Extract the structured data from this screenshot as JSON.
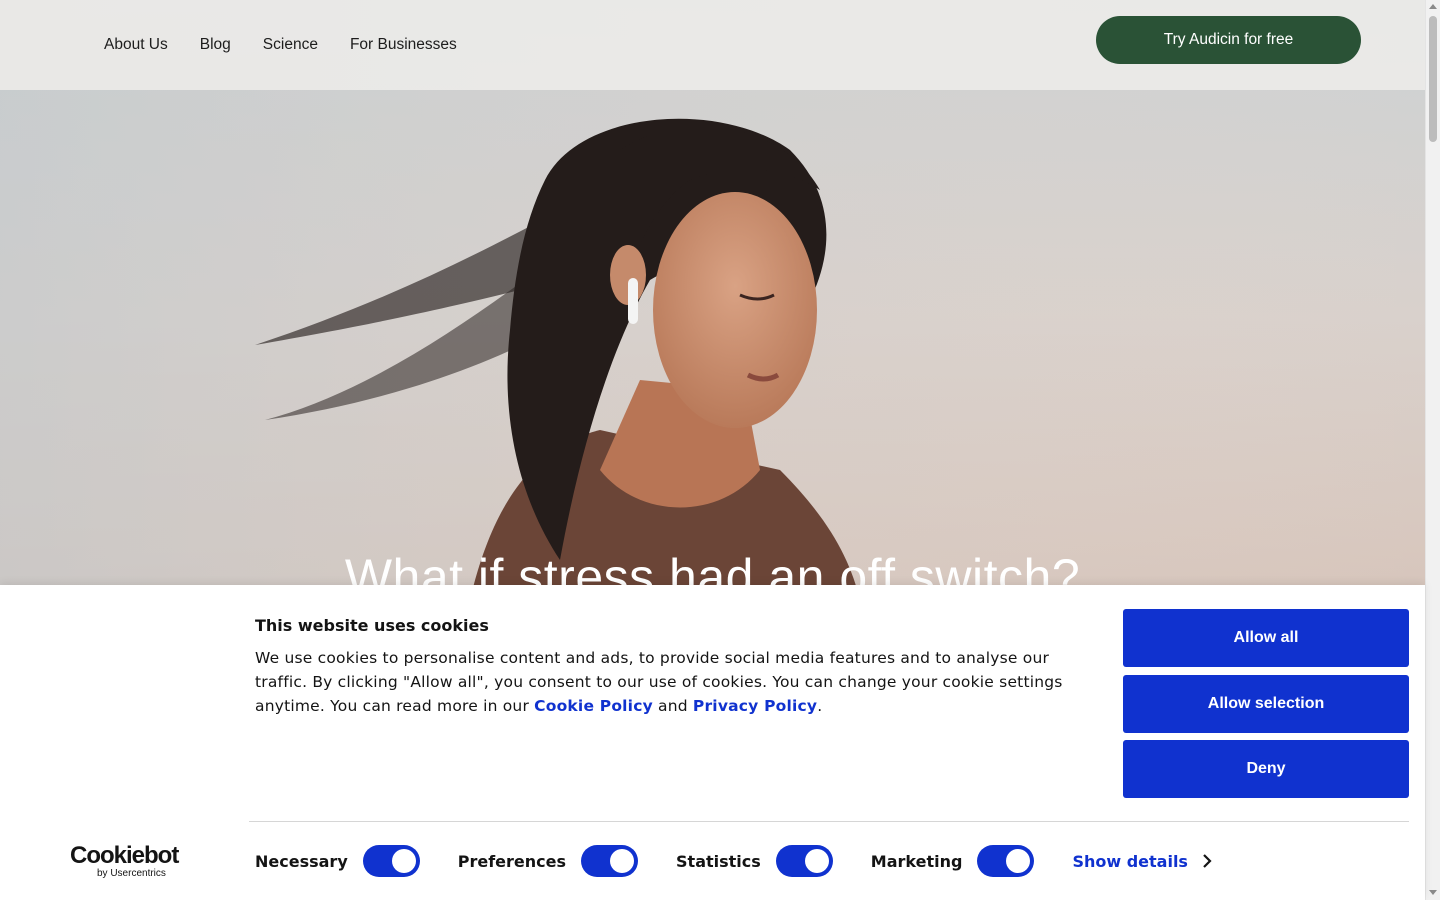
{
  "nav": {
    "links": [
      "About Us",
      "Blog",
      "Science",
      "For Businesses"
    ],
    "cta_label": "Try Audicin for free"
  },
  "hero": {
    "headline": "What if stress had an off switch?"
  },
  "cookie_banner": {
    "title": "This website uses cookies",
    "text_before": "We use cookies to personalise content and ads, to provide social media features and to analyse our traffic. By clicking \"Allow all\", you consent to our use of cookies. You can change your cookie settings anytime. You can read more in our ",
    "cookie_policy_link": "Cookie Policy",
    "text_and": " and ",
    "privacy_policy_link": "Privacy Policy",
    "text_end": ".",
    "buttons": {
      "allow_all": "Allow all",
      "allow_selection": "Allow selection",
      "deny": "Deny"
    },
    "logo": {
      "name": "Cookiebot",
      "sub": "by Usercentrics"
    },
    "toggles": [
      {
        "label": "Necessary",
        "on": true
      },
      {
        "label": "Preferences",
        "on": true
      },
      {
        "label": "Statistics",
        "on": true
      },
      {
        "label": "Marketing",
        "on": true
      }
    ],
    "show_details_label": "Show details"
  },
  "colors": {
    "cta_green": "#2a5236",
    "cookie_blue": "#1032cf"
  }
}
